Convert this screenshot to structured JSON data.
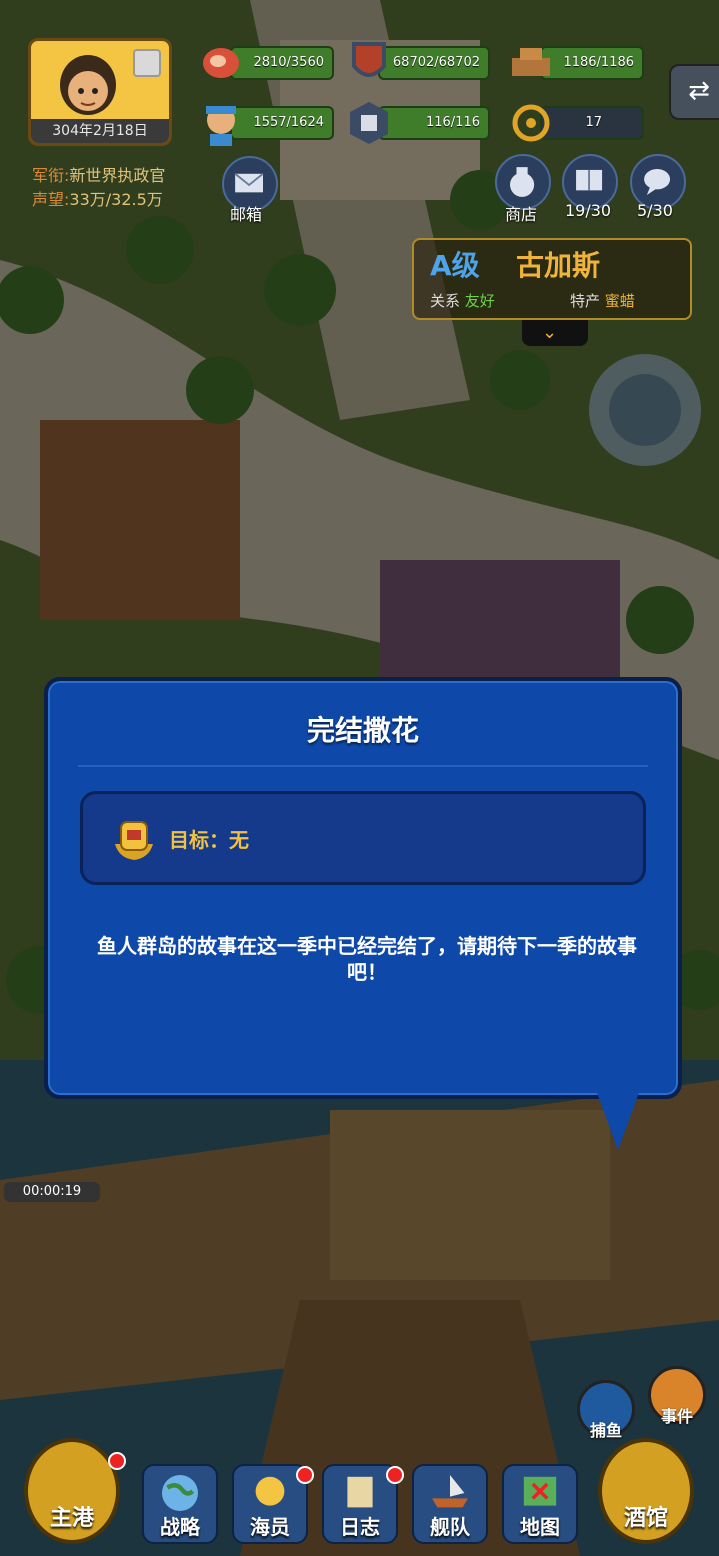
{
  "player": {
    "date": "304年2月18日",
    "rank_label": "军衔:",
    "rank_value": "新世界执政官",
    "fame_label": "声望:",
    "fame_value": "33万/32.5万"
  },
  "resources": {
    "meat": "2810/3560",
    "shield": "68702/68702",
    "wood": "1186/1186",
    "crew": "1557/1624",
    "power": "116/116",
    "helm": "17"
  },
  "menu": {
    "mail": "邮箱",
    "shop": "商店",
    "quests": "19/30",
    "chat": "5/30"
  },
  "town": {
    "grade": "A级",
    "name": "古加斯",
    "relation_label": "关系",
    "relation_value": "友好",
    "product_label": "特产",
    "product_value": "蜜蜡"
  },
  "dialog": {
    "title": "完结撒花",
    "goal": "目标：无",
    "message": "鱼人群岛的故事在这一季中已经完结了，请期待下一季的故事吧！"
  },
  "timer": "00:00:19",
  "side": {
    "fishing": "捕鱼",
    "events": "事件"
  },
  "nav": {
    "home": "主港",
    "strategy": "战略",
    "crew": "海员",
    "log": "日志",
    "fleet": "舰队",
    "map": "地图",
    "tavern": "酒馆"
  },
  "colors": {
    "dialog_bg": "#0e48a8",
    "gold": "#f2c23e",
    "friendly": "#6ad34a"
  }
}
